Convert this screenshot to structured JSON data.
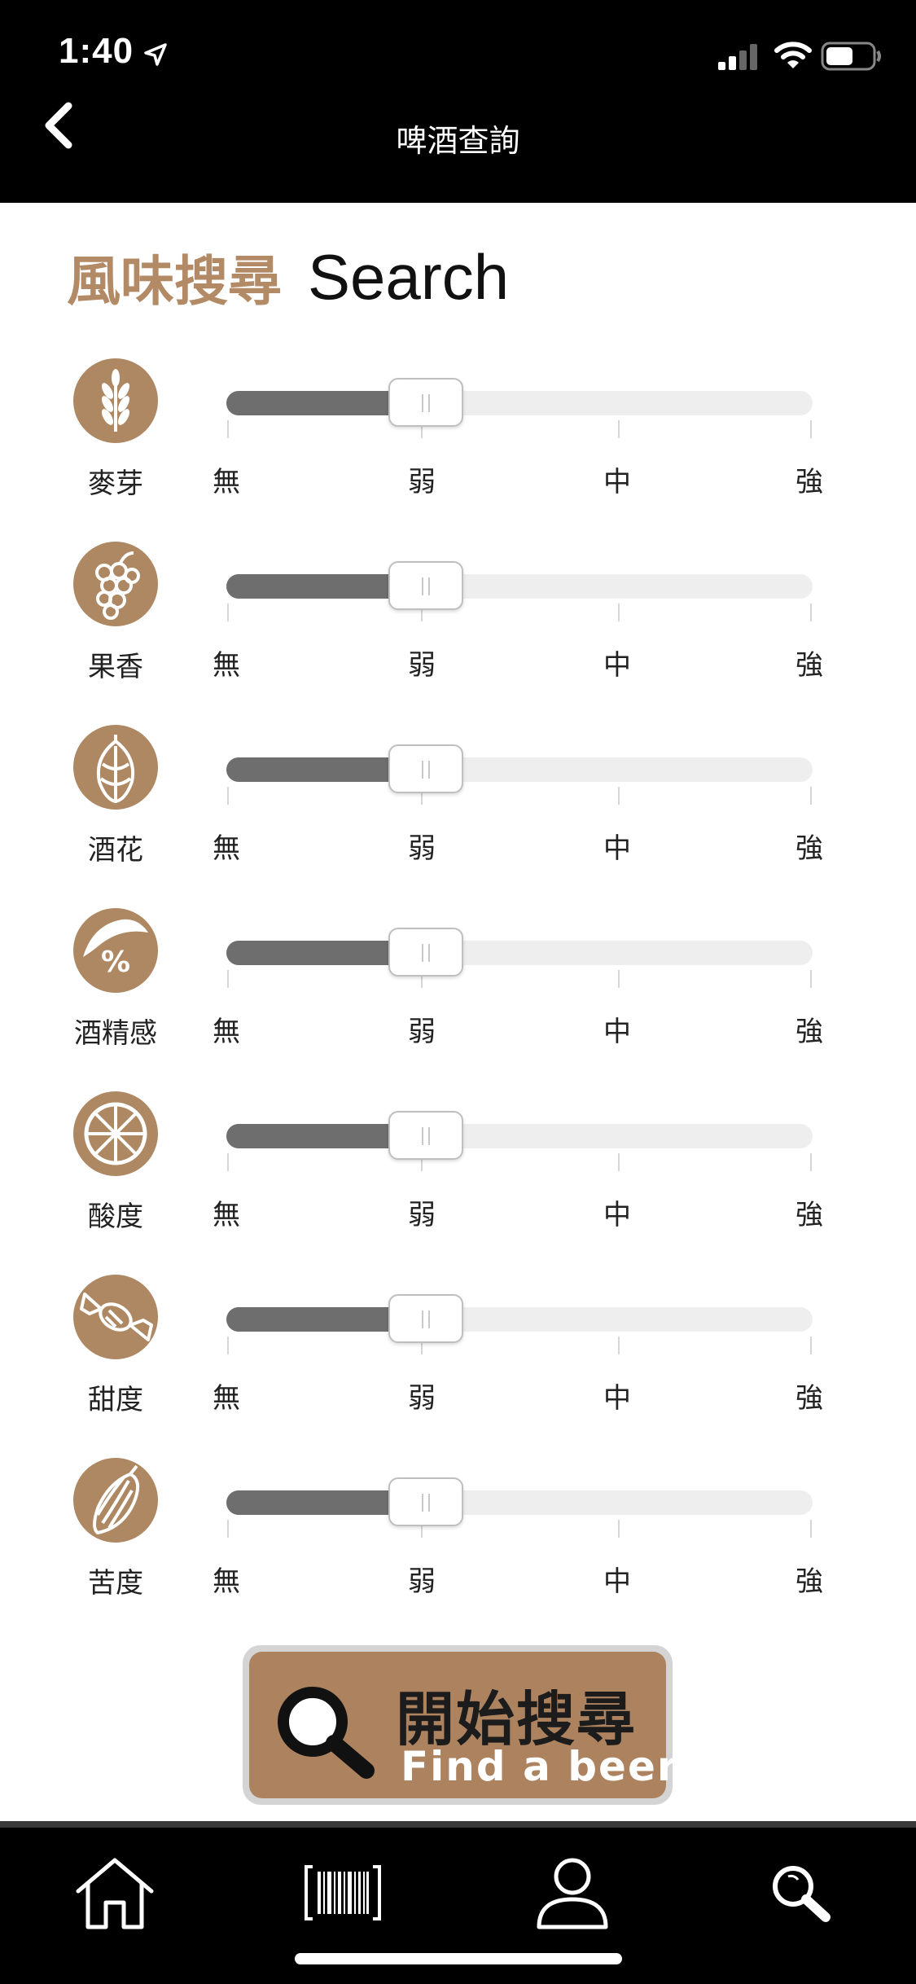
{
  "status_bar": {
    "time": "1:40"
  },
  "nav": {
    "title": "啤酒查詢"
  },
  "heading": {
    "zh": "風味搜尋",
    "en": "Search"
  },
  "scale_labels": [
    "無",
    "弱",
    "中",
    "強"
  ],
  "flavors": [
    {
      "label": "麥芽",
      "icon": "wheat-icon",
      "level": 1
    },
    {
      "label": "果香",
      "icon": "grape-icon",
      "level": 1
    },
    {
      "label": "酒花",
      "icon": "hop-icon",
      "level": 1
    },
    {
      "label": "酒精感",
      "icon": "percent-icon",
      "level": 1
    },
    {
      "label": "酸度",
      "icon": "citrus-icon",
      "level": 1
    },
    {
      "label": "甜度",
      "icon": "candy-icon",
      "level": 1
    },
    {
      "label": "苦度",
      "icon": "bitter-melon-icon",
      "level": 1
    }
  ],
  "search_button": {
    "zh": "開始搜尋",
    "en": "Find a beer"
  },
  "tabs": [
    "home-icon",
    "barcode-icon",
    "profile-icon",
    "search-icon"
  ],
  "colors": {
    "accent": "#ad8863",
    "track_fill": "#6e6e6e",
    "track": "#eeeeee"
  }
}
